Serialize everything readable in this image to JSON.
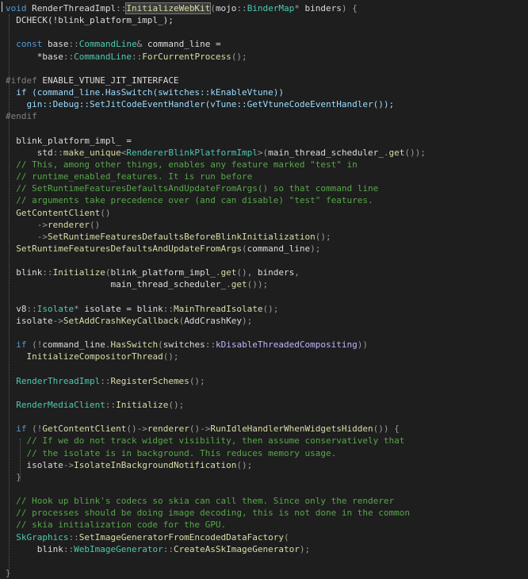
{
  "editor": {
    "lines": [
      [
        [
          "t",
          "void"
        ],
        [
          "n",
          " RenderThreadImpl"
        ],
        [
          "p",
          "::"
        ],
        [
          "h",
          "InitializeWebKit"
        ],
        [
          "p",
          "("
        ],
        [
          "n",
          "mojo"
        ],
        [
          "p",
          "::"
        ],
        [
          "t",
          "BinderMap"
        ],
        [
          "p",
          "* "
        ],
        [
          "n",
          "binders"
        ],
        [
          "p",
          ") {"
        ]
      ],
      [
        [
          "n",
          "  DCHECK(!blink_platform_impl_);"
        ]
      ],
      [],
      [
        [
          "n",
          "  "
        ],
        [
          "k",
          "const"
        ],
        [
          "n",
          " base"
        ],
        [
          "p",
          "::"
        ],
        [
          "t",
          "CommandLine"
        ],
        [
          "p",
          "& "
        ],
        [
          "n",
          "command_line ="
        ]
      ],
      [
        [
          "n",
          "      *base"
        ],
        [
          "p",
          "::"
        ],
        [
          "t",
          "CommandLine"
        ],
        [
          "p",
          "::"
        ],
        [
          "f",
          "ForCurrentProcess"
        ],
        [
          "p",
          "();"
        ]
      ],
      [],
      [
        [
          "d",
          "#ifdef"
        ],
        [
          "n",
          " ENABLE_VTUNE_JIT_INTERFACE"
        ]
      ],
      [
        [
          "n",
          "  "
        ],
        [
          "x",
          "if"
        ],
        [
          "x",
          " (command_line.HasSwitch(switches"
        ],
        [
          "x",
          "::"
        ],
        [
          "x",
          "kEnableVtune))"
        ]
      ],
      [
        [
          "x",
          "    gin"
        ],
        [
          "x",
          "::"
        ],
        [
          "x",
          "Debug"
        ],
        [
          "x",
          "::"
        ],
        [
          "x",
          "SetJitCodeEventHandler(vTune"
        ],
        [
          "x",
          "::"
        ],
        [
          "x",
          "GetVtuneCodeEventHandler());"
        ]
      ],
      [
        [
          "d",
          "#endif"
        ]
      ],
      [],
      [
        [
          "n",
          "  blink_platform_impl_ ="
        ]
      ],
      [
        [
          "n",
          "      std"
        ],
        [
          "p",
          "::"
        ],
        [
          "f",
          "make_unique"
        ],
        [
          "p",
          "<"
        ],
        [
          "t",
          "RendererBlinkPlatformImpl"
        ],
        [
          "p",
          ">("
        ],
        [
          "n",
          "main_thread_scheduler_"
        ],
        [
          "p",
          "."
        ],
        [
          "f",
          "get"
        ],
        [
          "p",
          "());"
        ]
      ],
      [
        [
          "c",
          "  // This, among other things, enables any feature marked \"test\" in"
        ]
      ],
      [
        [
          "c",
          "  // runtime_enabled_features. It is run before"
        ]
      ],
      [
        [
          "c",
          "  // SetRuntimeFeaturesDefaultsAndUpdateFromArgs() so that command line"
        ]
      ],
      [
        [
          "c",
          "  // arguments take precedence over (and can disable) \"test\" features."
        ]
      ],
      [
        [
          "n",
          "  "
        ],
        [
          "f",
          "GetContentClient"
        ],
        [
          "p",
          "()"
        ]
      ],
      [
        [
          "p",
          "      ->"
        ],
        [
          "f",
          "renderer"
        ],
        [
          "p",
          "()"
        ]
      ],
      [
        [
          "p",
          "      ->"
        ],
        [
          "f",
          "SetRuntimeFeaturesDefaultsBeforeBlinkInitialization"
        ],
        [
          "p",
          "();"
        ]
      ],
      [
        [
          "n",
          "  "
        ],
        [
          "f",
          "SetRuntimeFeaturesDefaultsAndUpdateFromArgs"
        ],
        [
          "p",
          "("
        ],
        [
          "n",
          "command_line"
        ],
        [
          "p",
          ");"
        ]
      ],
      [],
      [
        [
          "n",
          "  blink"
        ],
        [
          "p",
          "::"
        ],
        [
          "f",
          "Initialize"
        ],
        [
          "p",
          "("
        ],
        [
          "n",
          "blink_platform_impl_"
        ],
        [
          "p",
          "."
        ],
        [
          "f",
          "get"
        ],
        [
          "p",
          "(), "
        ],
        [
          "n",
          "binders"
        ],
        [
          "p",
          ","
        ]
      ],
      [
        [
          "n",
          "                    main_thread_scheduler_"
        ],
        [
          "p",
          "."
        ],
        [
          "f",
          "get"
        ],
        [
          "p",
          "());"
        ]
      ],
      [],
      [
        [
          "n",
          "  v8"
        ],
        [
          "p",
          "::"
        ],
        [
          "t",
          "Isolate"
        ],
        [
          "p",
          "* "
        ],
        [
          "n",
          "isolate = blink"
        ],
        [
          "p",
          "::"
        ],
        [
          "f",
          "MainThreadIsolate"
        ],
        [
          "p",
          "();"
        ]
      ],
      [
        [
          "n",
          "  isolate"
        ],
        [
          "p",
          "->"
        ],
        [
          "f",
          "SetAddCrashKeyCallback"
        ],
        [
          "p",
          "("
        ],
        [
          "n",
          "AddCrashKey"
        ],
        [
          "p",
          ");"
        ]
      ],
      [],
      [
        [
          "n",
          "  "
        ],
        [
          "k",
          "if"
        ],
        [
          "p",
          " (!"
        ],
        [
          "n",
          "command_line"
        ],
        [
          "p",
          "."
        ],
        [
          "f",
          "HasSwitch"
        ],
        [
          "p",
          "("
        ],
        [
          "n",
          "switches"
        ],
        [
          "p",
          "::"
        ],
        [
          "m",
          "kDisableThreadedCompositing"
        ],
        [
          "p",
          "))"
        ]
      ],
      [
        [
          "n",
          "    "
        ],
        [
          "f",
          "InitializeCompositorThread"
        ],
        [
          "p",
          "();"
        ]
      ],
      [],
      [
        [
          "n",
          "  "
        ],
        [
          "t",
          "RenderThreadImpl"
        ],
        [
          "p",
          "::"
        ],
        [
          "f",
          "RegisterSchemes"
        ],
        [
          "p",
          "();"
        ]
      ],
      [],
      [
        [
          "n",
          "  "
        ],
        [
          "t",
          "RenderMediaClient"
        ],
        [
          "p",
          "::"
        ],
        [
          "f",
          "Initialize"
        ],
        [
          "p",
          "();"
        ]
      ],
      [],
      [
        [
          "n",
          "  "
        ],
        [
          "k",
          "if"
        ],
        [
          "p",
          " (!"
        ],
        [
          "f",
          "GetContentClient"
        ],
        [
          "p",
          "()->"
        ],
        [
          "f",
          "renderer"
        ],
        [
          "p",
          "()->"
        ],
        [
          "f",
          "RunIdleHandlerWhenWidgetsHidden"
        ],
        [
          "p",
          "()) {"
        ]
      ],
      [
        [
          "c",
          "    // If we do not track widget visibility, then assume conservatively that"
        ]
      ],
      [
        [
          "c",
          "    // the isolate is in background. This reduces memory usage."
        ]
      ],
      [
        [
          "n",
          "    isolate"
        ],
        [
          "p",
          "->"
        ],
        [
          "f",
          "IsolateInBackgroundNotification"
        ],
        [
          "p",
          "();"
        ]
      ],
      [
        [
          "p",
          "  }"
        ]
      ],
      [],
      [
        [
          "c",
          "  // Hook up blink's codecs so skia can call them. Since only the renderer"
        ]
      ],
      [
        [
          "c",
          "  // processes should be doing image decoding, this is not done in the common"
        ]
      ],
      [
        [
          "c",
          "  // skia initialization code for the GPU."
        ]
      ],
      [
        [
          "n",
          "  "
        ],
        [
          "t",
          "SkGraphics"
        ],
        [
          "p",
          "::"
        ],
        [
          "f",
          "SetImageGeneratorFromEncodedDataFactory"
        ],
        [
          "p",
          "("
        ]
      ],
      [
        [
          "n",
          "      blink"
        ],
        [
          "p",
          "::"
        ],
        [
          "t",
          "WebImageGenerator"
        ],
        [
          "p",
          "::"
        ],
        [
          "f",
          "CreateAsSkImageGenerator"
        ],
        [
          "p",
          ");"
        ]
      ],
      [],
      [
        [
          "p",
          "}"
        ]
      ]
    ]
  }
}
